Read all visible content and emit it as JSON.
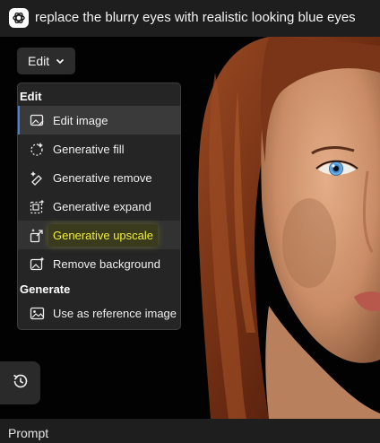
{
  "header": {
    "app_icon": "openai-logo-icon",
    "prompt": "replace the blurry eyes with realistic looking blue eyes"
  },
  "toolbar": {
    "edit_label": "Edit",
    "edit_chevron_icon": "chevron-down-icon"
  },
  "menu": {
    "edit_header": "Edit",
    "generate_header": "Generate",
    "items": [
      {
        "label": "Edit image",
        "icon": "edit-image-icon",
        "state": "selected"
      },
      {
        "label": "Generative fill",
        "icon": "generative-fill-icon"
      },
      {
        "label": "Generative remove",
        "icon": "generative-remove-icon"
      },
      {
        "label": "Generative expand",
        "icon": "generative-expand-icon"
      },
      {
        "label": "Generative upscale",
        "icon": "generative-upscale-icon",
        "state": "highlighted"
      },
      {
        "label": "Remove background",
        "icon": "remove-background-icon"
      },
      {
        "label": "Use as reference image",
        "icon": "reference-image-icon"
      }
    ]
  },
  "history": {
    "icon": "history-icon"
  },
  "footer": {
    "label": "Prompt"
  },
  "colors": {
    "background": "#1e1e1e",
    "menu_bg": "#252525",
    "selection_accent": "#4d7fd6",
    "highlight_text": "#f1ee3a",
    "hair": "#7a3418",
    "skin": "#d8a07c",
    "eye_iris": "#4b8fd0"
  }
}
